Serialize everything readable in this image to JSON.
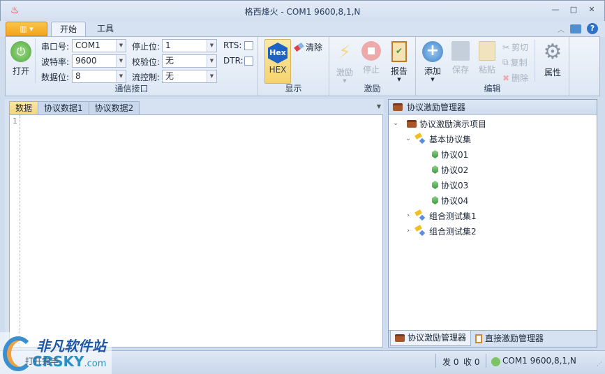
{
  "window": {
    "title": "格西烽火 - COM1  9600,8,1,N",
    "minimize": "—",
    "maximize": "□",
    "close": "✕"
  },
  "ribbon_tabs": [
    {
      "label": "开始",
      "active": true
    },
    {
      "label": "工具",
      "active": false
    }
  ],
  "comm": {
    "open_label": "打开",
    "group_label": "通信接口",
    "port_label": "串口号:",
    "port_value": "COM1",
    "baud_label": "波特率:",
    "baud_value": "9600",
    "databits_label": "数据位:",
    "databits_value": "8",
    "stopbits_label": "停止位:",
    "stopbits_value": "1",
    "parity_label": "校验位:",
    "parity_value": "无",
    "flow_label": "流控制:",
    "flow_value": "无",
    "rts_label": "RTS:",
    "rts_checked": false,
    "dtr_label": "DTR:",
    "dtr_checked": false
  },
  "display": {
    "hex_icon_text": "Hex",
    "hex_label": "HEX",
    "clear_label": "清除",
    "group_label": "显示"
  },
  "stimulus": {
    "stim_label": "激励",
    "stop_label": "停止",
    "report_label": "报告",
    "group_label": "激励"
  },
  "edit": {
    "add_label": "添加",
    "save_label": "保存",
    "paste_label": "粘贴",
    "cut_label": "剪切",
    "copy_label": "复制",
    "delete_label": "删除",
    "props_label": "属性",
    "group_label": "编辑"
  },
  "editor": {
    "tabs": [
      {
        "label": "数据",
        "active": true
      },
      {
        "label": "协议数据1"
      },
      {
        "label": "协议数据2"
      }
    ],
    "line_numbers": [
      "1"
    ]
  },
  "panel": {
    "title": "协议激励管理器",
    "tree": {
      "root": "协议激励演示项目",
      "sets": [
        {
          "label": "基本协议集",
          "expanded": true,
          "children": [
            "协议01",
            "协议02",
            "协议03",
            "协议04"
          ]
        },
        {
          "label": "组合测试集1",
          "expanded": false
        },
        {
          "label": "组合测试集2",
          "expanded": false
        }
      ]
    },
    "tabs": [
      {
        "label": "协议激励管理器",
        "active": true
      },
      {
        "label": "直接激励管理器"
      }
    ]
  },
  "status": {
    "left_text": "打开完毕",
    "send": "发 0",
    "recv": "收 0",
    "conn": "COM1  9600,8,1,N"
  },
  "watermark": {
    "cn": "非凡软件站",
    "en": "CRSKY",
    ".com": ".com"
  },
  "colors": {
    "accent": "#f2a417",
    "ribbon": "#dde7f4",
    "hex_active": "#f8d878"
  }
}
